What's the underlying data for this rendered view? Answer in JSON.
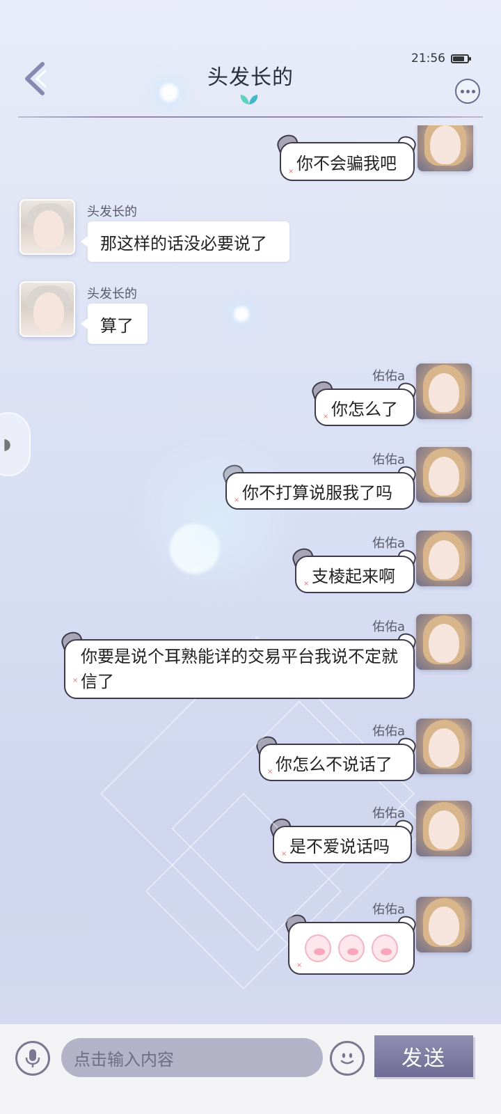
{
  "status_bar": {
    "time": "21:56",
    "battery_icon": "battery-icon"
  },
  "header": {
    "title": "头发长的",
    "back_icon": "back-chevron-icon",
    "more_icon": "more-dots-icon",
    "leaf_icon": "leaf-icon"
  },
  "messages": [
    {
      "side": "me",
      "name": "",
      "text": "你不会骗我吧"
    },
    {
      "side": "other",
      "name": "头发长的",
      "text": "那这样的话没必要说了"
    },
    {
      "side": "other",
      "name": "头发长的",
      "text": "算了"
    },
    {
      "side": "me",
      "name": "佑佑a",
      "text": "你怎么了"
    },
    {
      "side": "me",
      "name": "佑佑a",
      "text": "你不打算说服我了吗"
    },
    {
      "side": "me",
      "name": "佑佑a",
      "text": "支棱起来啊"
    },
    {
      "side": "me",
      "name": "佑佑a",
      "text": "你要是说个耳熟能详的交易平台我说不定就信了"
    },
    {
      "side": "me",
      "name": "佑佑a",
      "text": "你怎么不说话了"
    },
    {
      "side": "me",
      "name": "佑佑a",
      "text": "是不爱说话吗"
    },
    {
      "side": "me",
      "name": "佑佑a",
      "text": "",
      "stickers": [
        "pig-face-sticker",
        "pig-face-sticker",
        "pig-face-sticker"
      ]
    }
  ],
  "composer": {
    "placeholder": "点击输入内容",
    "send_label": "发送",
    "mic_icon": "microphone-icon",
    "emoji_icon": "emoji-face-icon"
  },
  "colors": {
    "accent": "#6f6d93",
    "input_bg": "#b3b2c6",
    "bubble_border": "#3d3a4a"
  }
}
